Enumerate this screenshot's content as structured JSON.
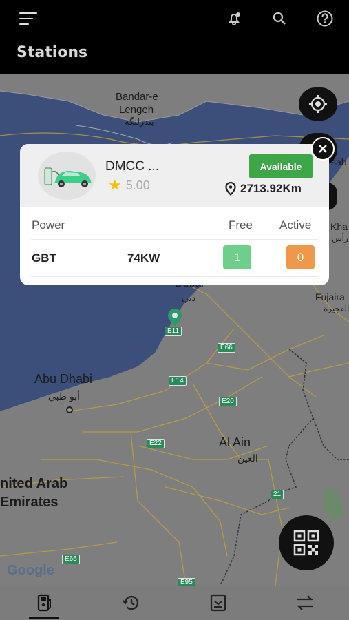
{
  "header": {
    "title": "Stations"
  },
  "icons": {
    "menu": "menu-icon",
    "notification": "notification-bell-icon",
    "search": "search-icon",
    "help": "help-icon",
    "locate": "my-location-icon",
    "qr": "qr-code-icon",
    "close": "close-icon"
  },
  "map": {
    "labels": {
      "bandar": "Bandar-e",
      "lengeh": "Lengeh",
      "lengeh_ar": "بندرلنگه",
      "abu_dhabi": "Abu Dhabi",
      "abu_dhabi_ar": "أبو ظبي",
      "al_ain": "Al Ain",
      "al_ain_ar": "العين",
      "uae_1": "nited Arab",
      "uae_2": "Emirates",
      "fujairah": "Fujaira",
      "fujairah_ar": "الفجيرة",
      "dubai": "Dubai",
      "dubai_ar": "دبي",
      "sab": "sab",
      "kha": "Kha",
      "kha_ar": "رأس",
      "google": "Google"
    },
    "roads": [
      "E11",
      "E66",
      "E14",
      "E20",
      "E22",
      "E65",
      "E95",
      "21"
    ]
  },
  "station": {
    "name": "DMCC ...",
    "rating": "5.00",
    "status": "Available",
    "distance": "2713.92Km",
    "columns": {
      "power": "Power",
      "free": "Free",
      "active": "Active"
    },
    "row": {
      "type": "GBT",
      "power": "74KW",
      "free": "1",
      "active": "0"
    }
  },
  "colors": {
    "available": "#3da647",
    "free": "#6dcf89",
    "active": "#f0984a",
    "pin": "#2b9a6c"
  },
  "bottom_nav": [
    {
      "name": "stations",
      "icon": "charging-station-icon",
      "active": true
    },
    {
      "name": "history",
      "icon": "history-icon",
      "active": false
    },
    {
      "name": "bookings",
      "icon": "booking-icon",
      "active": false
    },
    {
      "name": "transactions",
      "icon": "swap-arrows-icon",
      "active": false
    }
  ]
}
